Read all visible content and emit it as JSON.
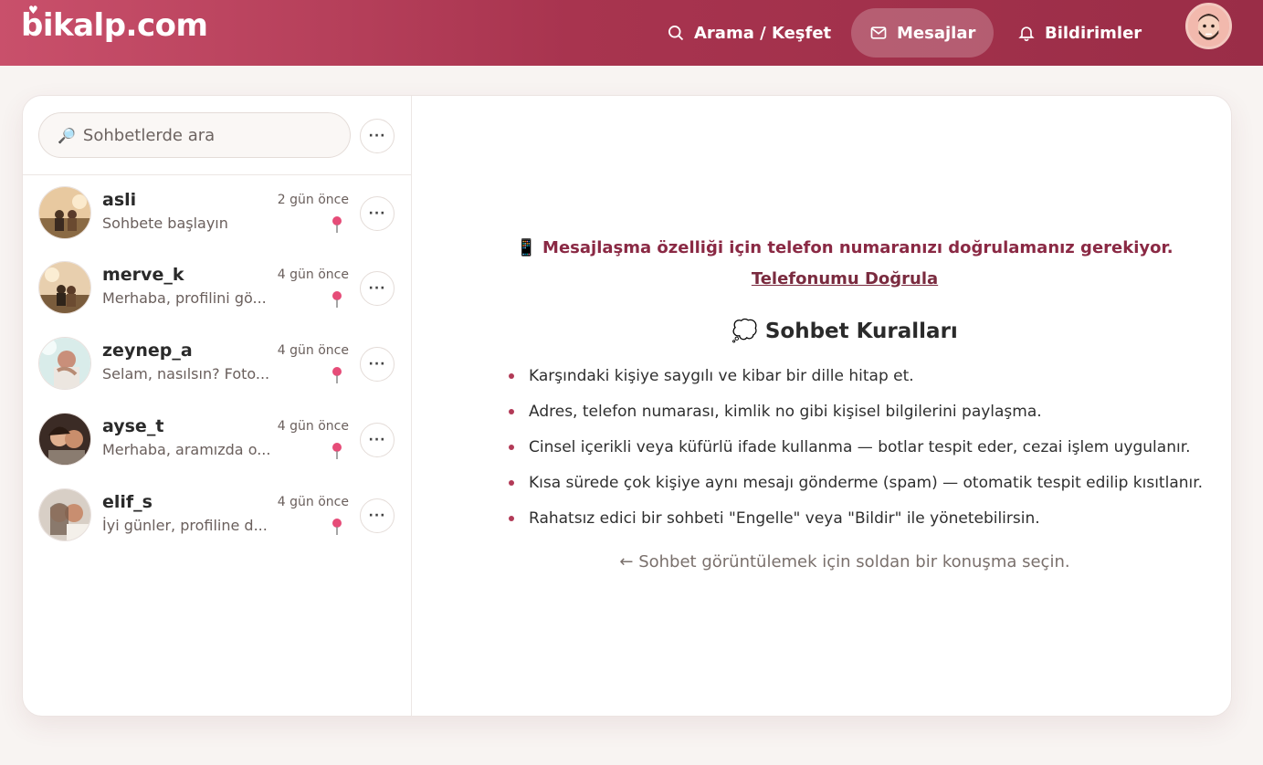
{
  "brand": {
    "logo_text": "bikalp.com"
  },
  "nav": {
    "items": [
      {
        "label": "Arama / Keşfet",
        "icon": "search-icon",
        "active": false
      },
      {
        "label": "Mesajlar",
        "icon": "mail-icon",
        "active": true
      },
      {
        "label": "Bildirimler",
        "icon": "bell-icon",
        "active": false
      }
    ]
  },
  "sidebar": {
    "search_placeholder": "Sohbetlerde ara",
    "search_icon": "🔎",
    "chats": [
      {
        "name": "asli",
        "preview": "Sohbete başlayın",
        "time": "2 gün önce"
      },
      {
        "name": "merve_k",
        "preview": "Merhaba, profilini gö...",
        "time": "4 gün önce"
      },
      {
        "name": "zeynep_a",
        "preview": "Selam, nasılsın? Foto...",
        "time": "4 gün önce"
      },
      {
        "name": "ayse_t",
        "preview": "Merhaba, aramızda o...",
        "time": "4 gün önce"
      },
      {
        "name": "elif_s",
        "preview": "İyi günler, profiline d...",
        "time": "4 gün önce"
      }
    ]
  },
  "main": {
    "verify_text": "📱 Mesajlaşma özelliği için telefon numaranızı doğrulamanız gerekiyor.",
    "verify_link": "Telefonumu Doğrula",
    "rules_title": "💭 Sohbet Kuralları",
    "rules": [
      "Karşındaki kişiye saygılı ve kibar bir dille hitap et.",
      "Adres, telefon numarası, kimlik no gibi kişisel bilgilerini paylaşma.",
      "Cinsel içerikli veya küfürlü ifade kullanma — botlar tespit eder, cezai işlem uygulanır.",
      "Kısa sürede çok kişiye aynı mesajı gönderme (spam) — otomatik tespit edilip kısıtlanır.",
      "Rahatsız edici bir sohbeti \"Engelle\" veya \"Bildir\" ile yönetebilirsin."
    ],
    "hint": "← Sohbet görüntülemek için soldan bir konuşma seçin."
  },
  "colors": {
    "header_start": "#c9506b",
    "header_end": "#9a2d47",
    "accent": "#8a2944"
  }
}
